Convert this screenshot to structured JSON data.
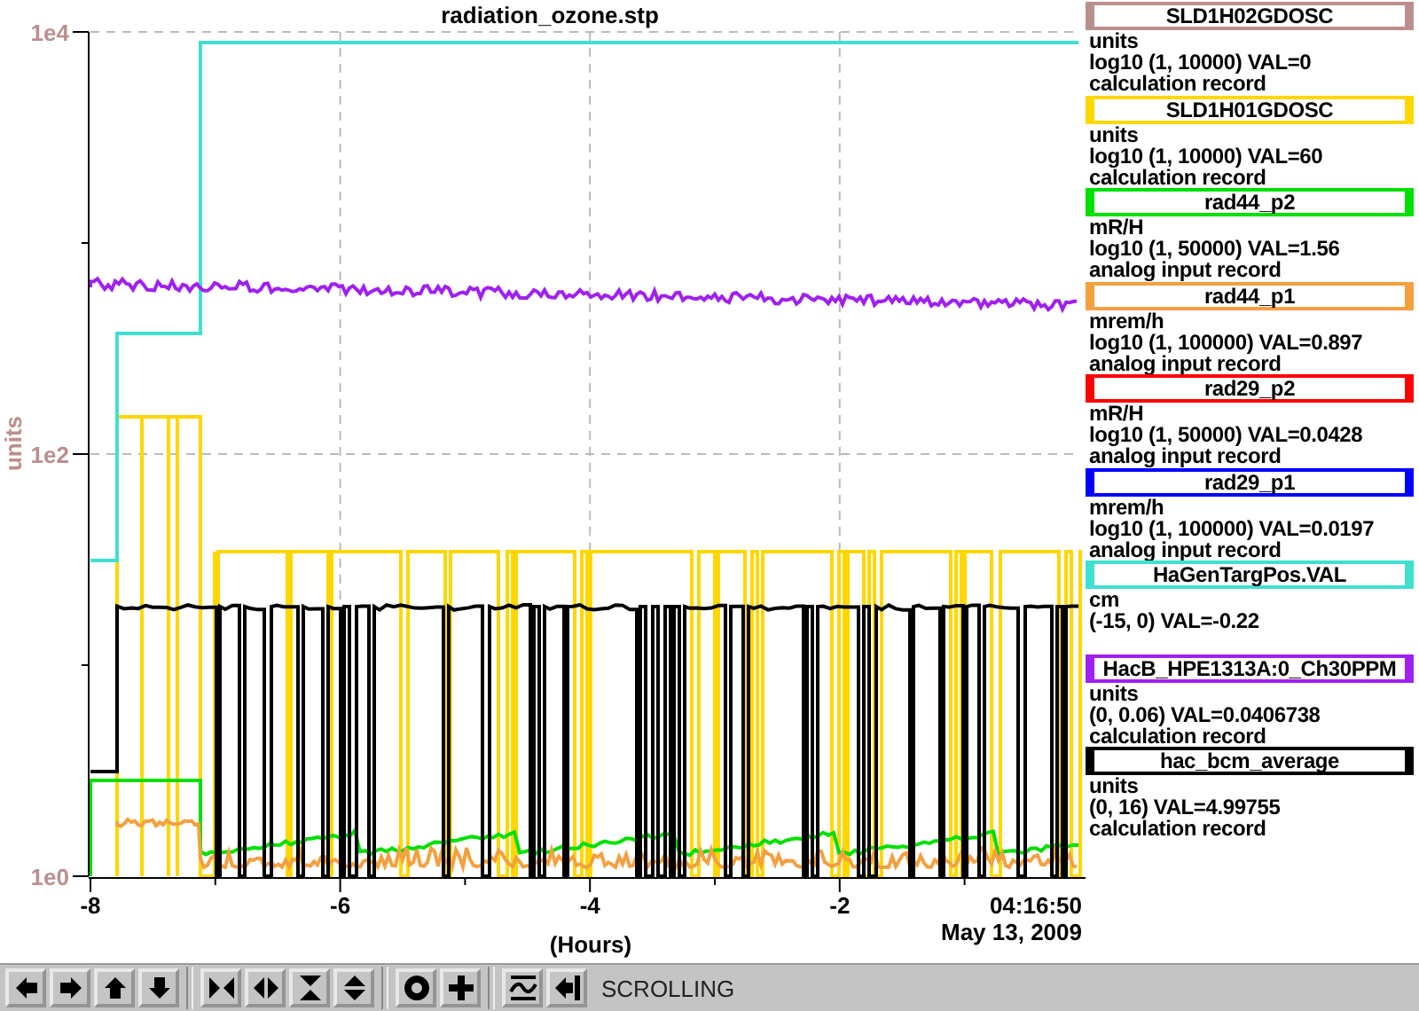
{
  "chart": {
    "title": "radiation_ozone.stp",
    "ylabel": "units",
    "yticks": [
      "1e4",
      "1e2",
      "1e0"
    ],
    "xticks": [
      "-8",
      "-6",
      "-4",
      "-2"
    ],
    "time": "04:16:50",
    "date": "May 13, 2009",
    "xlabel": "(Hours)"
  },
  "legend": [
    {
      "name": "SLD1H02GDOSC",
      "color": "#bc8f8f",
      "lines": [
        "units",
        "log10 (1, 10000)  VAL=0",
        "calculation record"
      ]
    },
    {
      "name": "SLD1H01GDOSC",
      "color": "#ffd700",
      "lines": [
        "units",
        "log10 (1, 10000) VAL=60",
        "calculation record"
      ]
    },
    {
      "name": "rad44_p2",
      "color": "#00e000",
      "lines": [
        "mR/H",
        "log10 (1, 50000) VAL=1.56",
        "analog input record"
      ]
    },
    {
      "name": "rad44_p1",
      "color": "#f4a040",
      "lines": [
        "mrem/h",
        "log10 (1, 100000) VAL=0.897",
        "analog input record"
      ]
    },
    {
      "name": "rad29_p2",
      "color": "#ff0000",
      "lines": [
        "mR/H",
        "log10 (1, 50000) VAL=0.0428",
        "analog input record"
      ]
    },
    {
      "name": "rad29_p1",
      "color": "#0000ff",
      "lines": [
        "mrem/h",
        "log10 (1, 100000) VAL=0.0197",
        "analog input record"
      ]
    },
    {
      "name": "HaGenTargPos.VAL",
      "color": "#40e0d0",
      "lines": [
        "cm",
        "(-15, 0) VAL=-0.22"
      ]
    },
    {
      "name": "HacB_HPE1313A:0_Ch30PPM",
      "color": "#a020f0",
      "lines": [
        "units",
        "(0, 0.06) VAL=0.0406738",
        "calculation record"
      ]
    },
    {
      "name": "hac_bcm_average",
      "color": "#000000",
      "lines": [
        "units",
        "(0, 16) VAL=4.99755",
        "calculation record"
      ]
    }
  ],
  "toolbar": {
    "status": "SCROLLING"
  }
}
